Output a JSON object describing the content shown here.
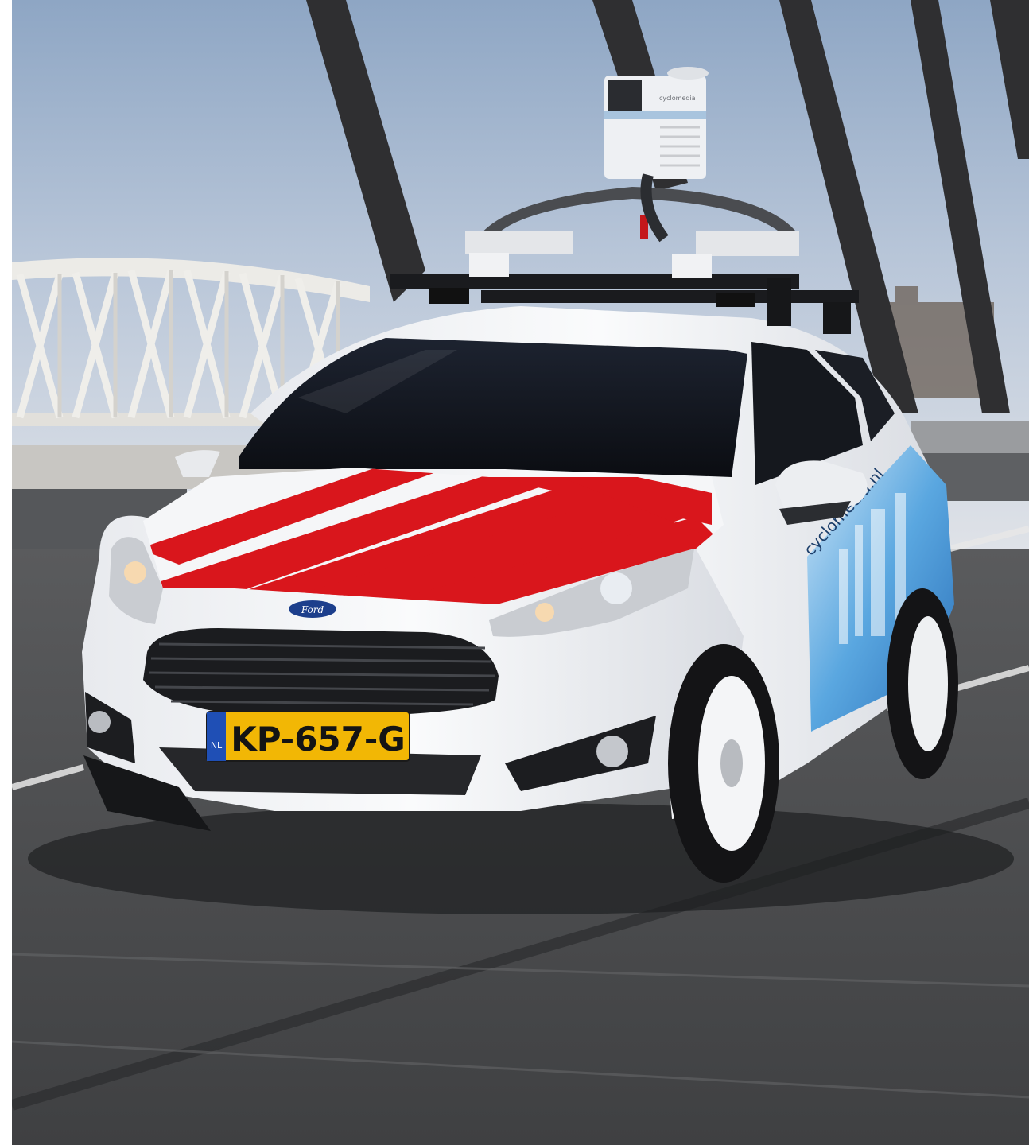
{
  "photo": {
    "license_plate": {
      "country_code": "NL",
      "number": "KP-657-G",
      "plate_color": "#f2b705",
      "band_color": "#1f4fb5"
    },
    "car_brand_badge": "Ford",
    "side_decal_text": "cyclomedia.nl",
    "camera_unit_text": "cyclomedia",
    "colors": {
      "sky_top": "#9fb4cf",
      "sky_bottom": "#d7dde6",
      "car_body": "#f3f4f6",
      "hood_stripe_red": "#d9161c",
      "road": "#4a4b4d",
      "bridge_truss": "#e9e7e2"
    }
  }
}
